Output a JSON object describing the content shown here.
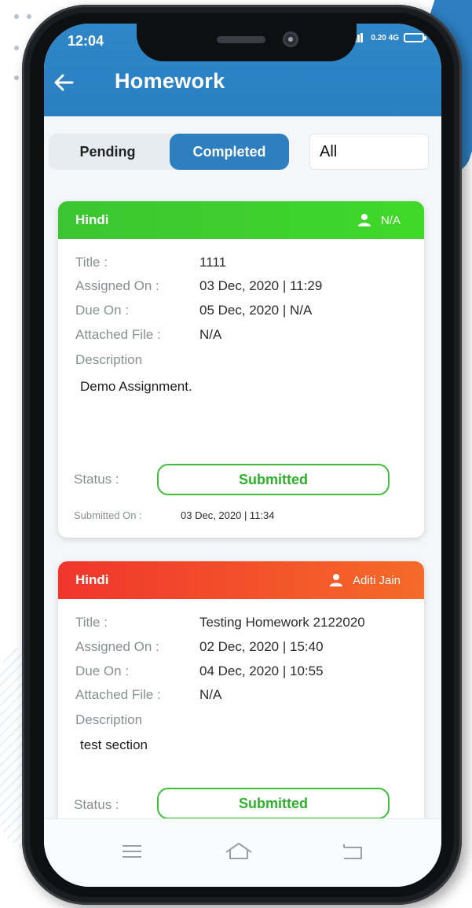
{
  "status_bar": {
    "time": "12:04",
    "right_info": "0.20 4G"
  },
  "app_bar": {
    "title": "Homework"
  },
  "tabs": [
    {
      "label": "Pending",
      "active": false
    },
    {
      "label": "Completed",
      "active": true
    }
  ],
  "filter": {
    "selected": "All"
  },
  "field_labels": {
    "title": "Title :",
    "assigned_on": "Assigned On :",
    "due_on": "Due On :",
    "attached_file": "Attached File :",
    "description": "Description",
    "status": "Status :",
    "submitted_on": "Submitted On :"
  },
  "cards": [
    {
      "subject": "Hindi",
      "person": "N/A",
      "title": "1111",
      "assigned_on": "03 Dec, 2020 | 11:29",
      "due_on": "05 Dec, 2020 | N/A",
      "attached_file": "N/A",
      "description": "Demo Assignment.",
      "status": "Submitted",
      "submitted_on": "03 Dec, 2020 | 11:34",
      "header_color": "#3fd92a"
    },
    {
      "subject": "Hindi",
      "person": "Aditi Jain",
      "title": "Testing Homework 2122020",
      "assigned_on": "02 Dec, 2020 | 15:40",
      "due_on": "04 Dec, 2020 | 10:55",
      "attached_file": "N/A",
      "description": "test section",
      "status": "Submitted",
      "header_color": "#f0352d"
    }
  ],
  "colors": {
    "app_bar": "#2a7fc0",
    "accent": "#2d7fc0",
    "status_green": "#3dbf3a"
  },
  "nav_icons": [
    "menu-icon",
    "home-icon",
    "back-icon"
  ]
}
